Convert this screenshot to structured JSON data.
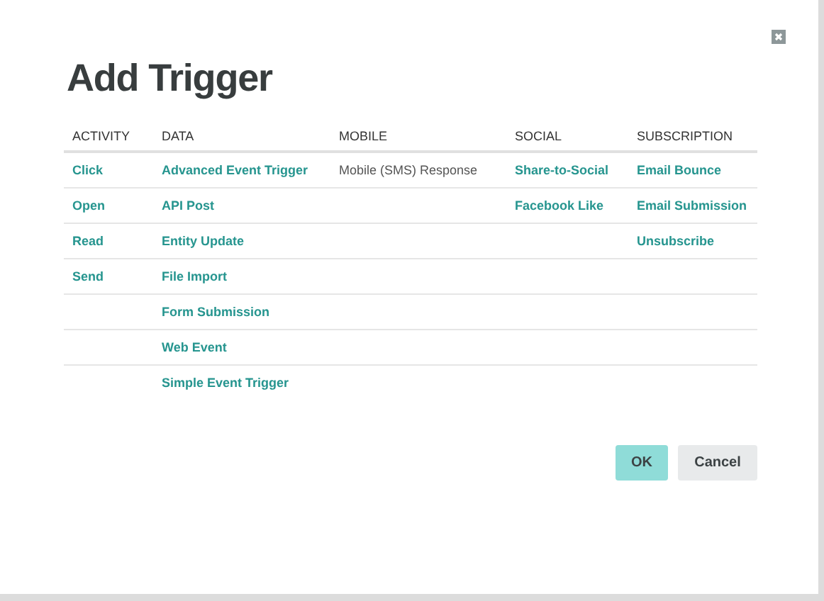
{
  "dialog": {
    "title": "Add Trigger",
    "columns": [
      {
        "heading": "ACTIVITY",
        "items": [
          {
            "label": "Click",
            "disabled": false
          },
          {
            "label": "Open",
            "disabled": false
          },
          {
            "label": "Read",
            "disabled": false
          },
          {
            "label": "Send",
            "disabled": false
          }
        ]
      },
      {
        "heading": "DATA",
        "items": [
          {
            "label": "Advanced Event Trigger",
            "disabled": false
          },
          {
            "label": "API Post",
            "disabled": false
          },
          {
            "label": "Entity Update",
            "disabled": false
          },
          {
            "label": "File Import",
            "disabled": false
          },
          {
            "label": "Form Submission",
            "disabled": false
          },
          {
            "label": "Web Event",
            "disabled": false
          },
          {
            "label": "Simple Event Trigger",
            "disabled": false
          }
        ]
      },
      {
        "heading": "MOBILE",
        "items": [
          {
            "label": "Mobile (SMS) Response",
            "disabled": true
          }
        ]
      },
      {
        "heading": "SOCIAL",
        "items": [
          {
            "label": "Share-to-Social",
            "disabled": false
          },
          {
            "label": "Facebook Like",
            "disabled": false
          }
        ]
      },
      {
        "heading": "SUBSCRIPTION",
        "items": [
          {
            "label": "Email Bounce",
            "disabled": false
          },
          {
            "label": "Email Submission",
            "disabled": false
          },
          {
            "label": "Unsubscribe",
            "disabled": false
          }
        ]
      }
    ],
    "buttons": [
      {
        "label": "OK",
        "kind": "primary"
      },
      {
        "label": "Cancel",
        "kind": "secondary"
      }
    ]
  }
}
